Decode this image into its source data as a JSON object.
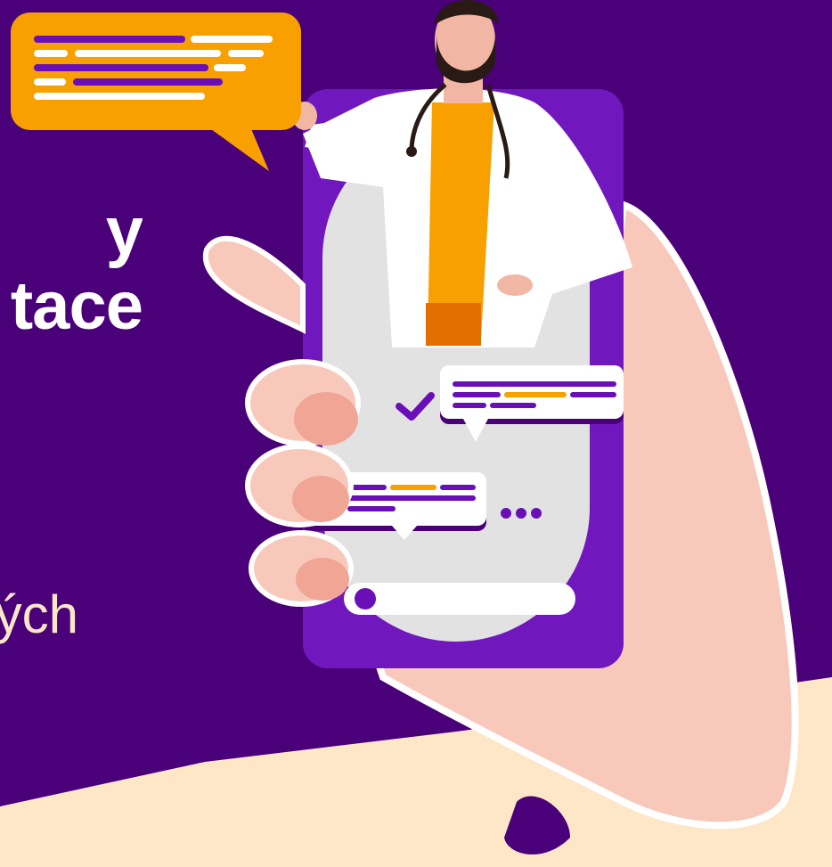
{
  "headline": {
    "line1": "y",
    "line2": "tace"
  },
  "subtext": "ých",
  "colors": {
    "background": "#4a0079",
    "floor": "#fde7c7",
    "phone": "#6a0fb8",
    "screen": "#e2e2e2",
    "accent": "#f7a000",
    "skin": "#f8c9bb",
    "white": "#ffffff"
  },
  "icons": [
    "chat-bubble-icon",
    "check-icon",
    "typing-dots-icon",
    "doctor-illustration",
    "stethoscope-icon"
  ]
}
